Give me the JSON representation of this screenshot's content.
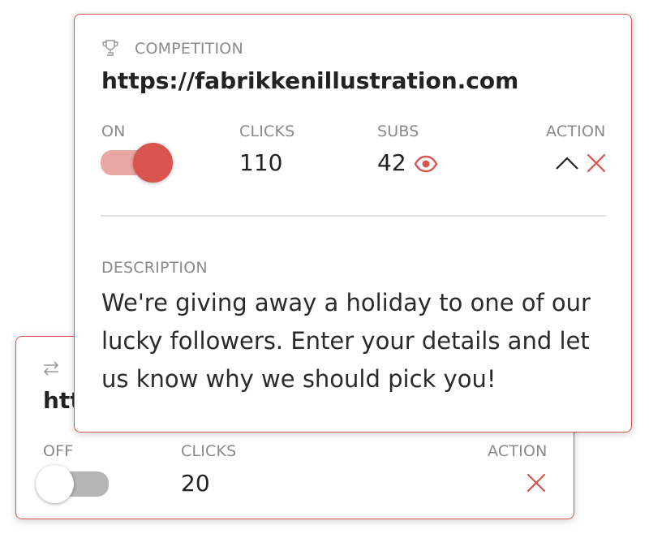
{
  "cards": [
    {
      "type_label": "COMPETITION",
      "url": "https://fabrikkenillustration.com",
      "status_label": "ON",
      "clicks_label": "CLICKS",
      "clicks_value": "110",
      "subs_label": "SUBS",
      "subs_value": "42",
      "action_label": "ACTION",
      "description_label": "DESCRIPTION",
      "description": "We're giving away a holiday to one of our lucky followers. Enter your details and let us know why we should pick you!",
      "toggle_on": true
    },
    {
      "url_visible_fragment": "htt",
      "status_label": "OFF",
      "clicks_label": "CLICKS",
      "clicks_value": "20",
      "action_label": "ACTION",
      "toggle_on": false
    }
  ],
  "colors": {
    "accent": "#d9534f",
    "toggle_on_track": "#e8a7a3",
    "toggle_off_track": "#b5b5b5",
    "label_gray": "#8a8a8a"
  },
  "icons": {
    "type_icon_front": "trophy-icon",
    "type_icon_back": "redirect-arrows-icon",
    "subs_icon": "eye-icon",
    "collapse_icon": "chevron-up-icon",
    "delete_icon": "close-icon"
  }
}
